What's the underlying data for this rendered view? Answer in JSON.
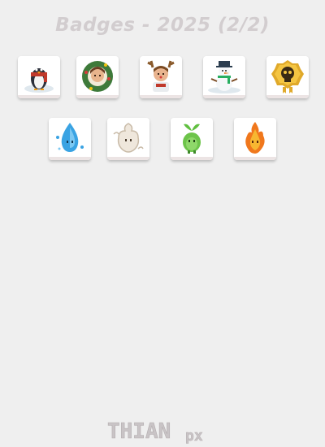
{
  "header": {
    "title": "Badges - 2025 (2/2)"
  },
  "badges": {
    "row1": [
      {
        "icon": "penguin-icon"
      },
      {
        "icon": "wreath-portrait-icon"
      },
      {
        "icon": "reindeer-antlers-portrait-icon"
      },
      {
        "icon": "snowman-icon"
      },
      {
        "icon": "gold-skull-icon"
      }
    ],
    "row2": [
      {
        "icon": "water-spirit-icon"
      },
      {
        "icon": "air-spirit-icon"
      },
      {
        "icon": "earth-sprout-spirit-icon"
      },
      {
        "icon": "fire-spirit-icon"
      }
    ]
  },
  "footer": {
    "logo_main": "THIAN",
    "logo_suffix": "px"
  },
  "colors": {
    "background": "#efefef",
    "title": "#d2cdcf",
    "logo": "#c9c4c6"
  }
}
